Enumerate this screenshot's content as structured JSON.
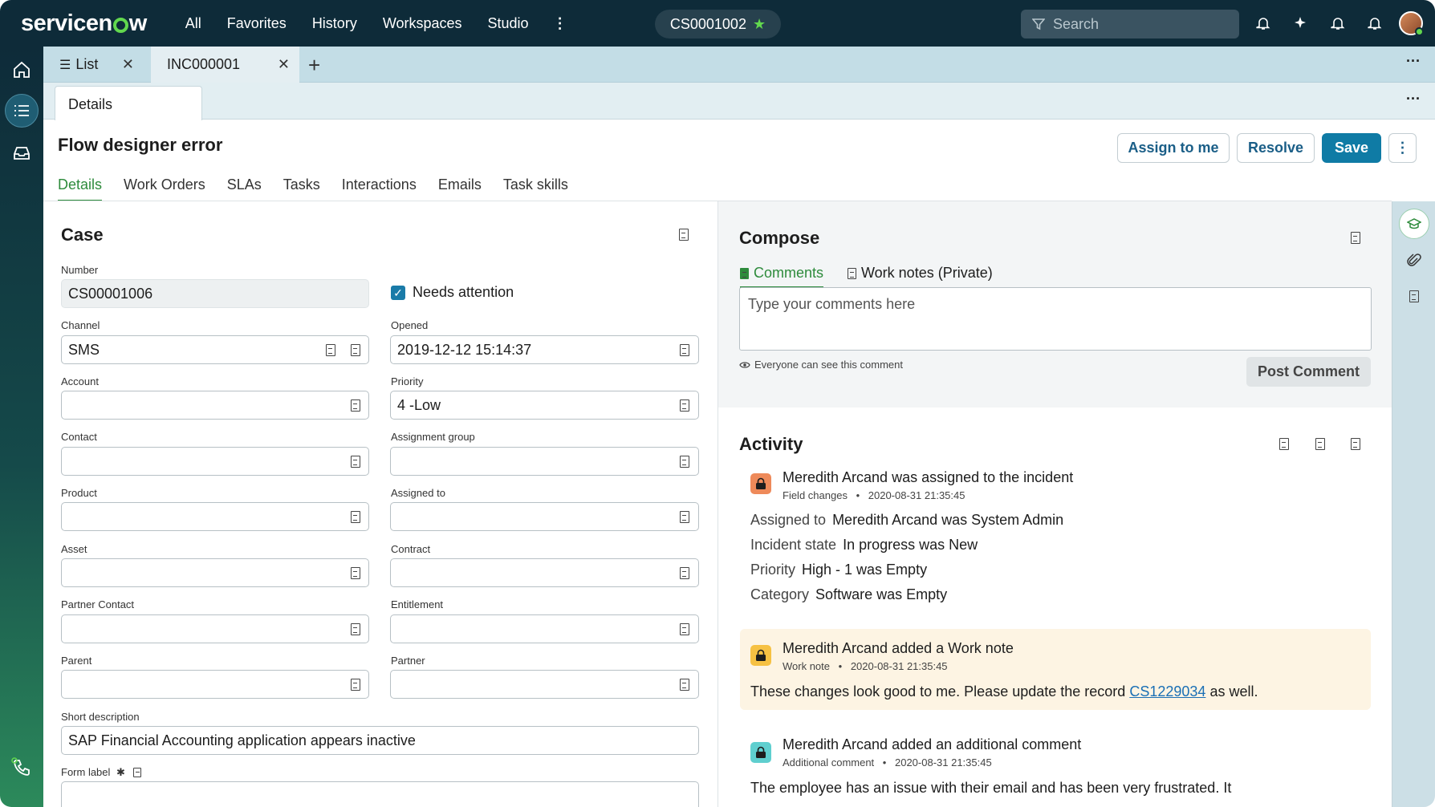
{
  "topbar": {
    "brand": "servicenow",
    "nav": [
      "All",
      "Favorites",
      "History",
      "Workspaces",
      "Studio"
    ],
    "record_pill": "CS0001002",
    "search_placeholder": "Search"
  },
  "tabs": [
    {
      "label": "List"
    },
    {
      "label": "INC000001"
    }
  ],
  "subtab": "Details",
  "header": {
    "title": "Flow designer error",
    "buttons": {
      "assign": "Assign to me",
      "resolve": "Resolve",
      "save": "Save"
    },
    "form_tabs": [
      "Details",
      "Work Orders",
      "SLAs",
      "Tasks",
      "Interactions",
      "Emails",
      "Task skills"
    ]
  },
  "case": {
    "title": "Case",
    "number_label": "Number",
    "number_value": "CS00001006",
    "needs_attention_label": "Needs attention",
    "channel_label": "Channel",
    "channel_value": "SMS",
    "opened_label": "Opened",
    "opened_value": "2019-12-12 15:14:37",
    "account_label": "Account",
    "priority_label": "Priority",
    "priority_value": "4 -Low",
    "contact_label": "Contact",
    "assignment_group_label": "Assignment group",
    "product_label": "Product",
    "assigned_to_label": "Assigned to",
    "asset_label": "Asset",
    "contract_label": "Contract",
    "partner_contact_label": "Partner Contact",
    "entitlement_label": "Entitlement",
    "parent_label": "Parent",
    "partner_label": "Partner",
    "short_description_label": "Short description",
    "short_description_value": "SAP Financial Accounting application appears inactive",
    "form_label_label": "Form label"
  },
  "compose": {
    "title": "Compose",
    "tab_comments": "Comments",
    "tab_work_notes": "Work notes (Private)",
    "placeholder": "Type your comments here",
    "visibility_note": "Everyone can see this comment",
    "post_button": "Post Comment"
  },
  "activity": {
    "title": "Activity",
    "entries": [
      {
        "title": "Meredith Arcand was assigned to the incident",
        "type": "Field changes",
        "time": "2020-08-31 21:35:45",
        "changes": [
          {
            "field": "Assigned to",
            "value": "Meredith Arcand was System Admin"
          },
          {
            "field": "Incident state",
            "value": "In progress was New"
          },
          {
            "field": "Priority",
            "value": "High - 1 was Empty"
          },
          {
            "field": "Category",
            "value": "Software was Empty"
          }
        ]
      },
      {
        "title": "Meredith Arcand added a Work note",
        "type": "Work note",
        "time": "2020-08-31 21:35:45",
        "text_before": "These changes look good to me. Please update the record",
        "link": "CS1229034",
        "text_after": "as well."
      },
      {
        "title": "Meredith Arcand added an additional comment",
        "type": "Additional comment",
        "time": "2020-08-31 21:35:45",
        "text": "The employee has an issue with their email and has been very frustrated. It"
      }
    ]
  },
  "colors": {
    "topbar": "#0e2b39",
    "accent_green": "#62d84e",
    "primary_button": "#0f7ba5",
    "selected_tab": "#2e8b3c",
    "work_note_bg": "#fdf4e3"
  },
  "icons": [
    "home-icon",
    "list-icon",
    "inbox-icon",
    "phone-icon",
    "filter-icon",
    "bell-icon",
    "sparkle-icon",
    "graduation-cap-icon",
    "paperclip-icon",
    "document-icon",
    "lock-icon",
    "eye-icon"
  ]
}
